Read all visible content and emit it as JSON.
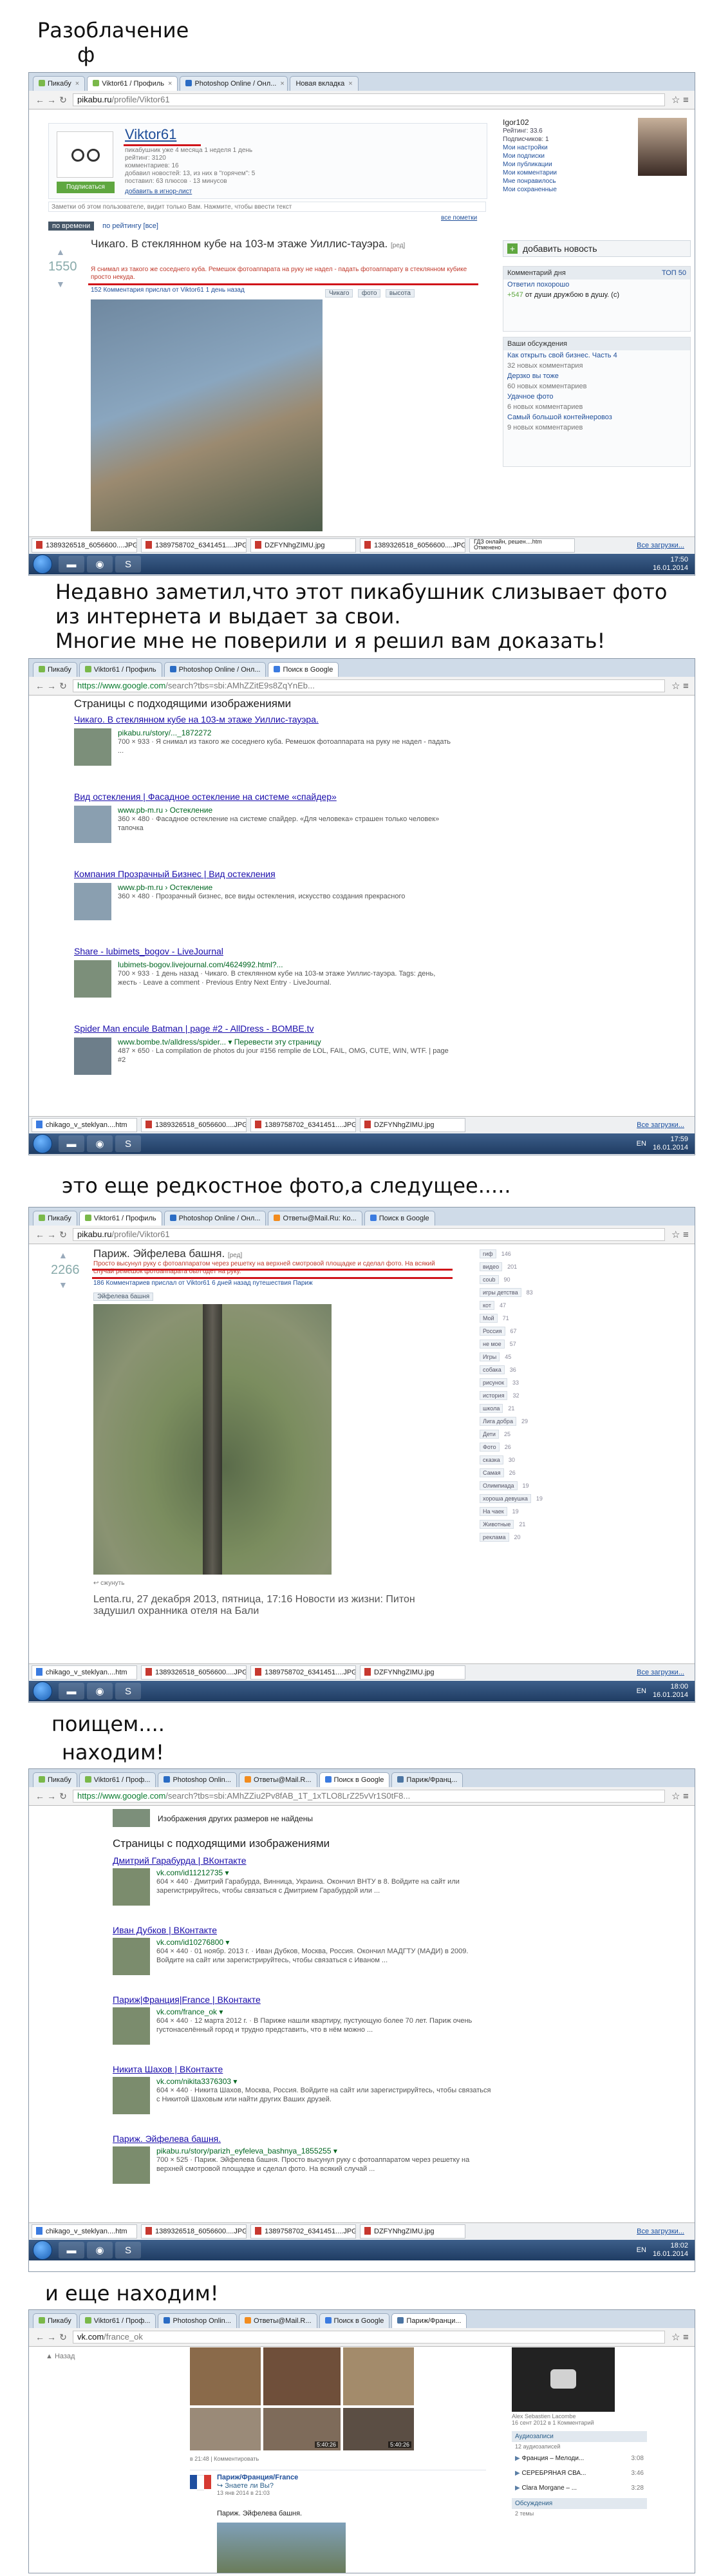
{
  "captions": {
    "title_line1": "Разоблачение",
    "title_line2": "ф",
    "after_shot1": "Недавно заметил,что этот пикабушник слизывает фото\nиз интернета и выдает за свои.\nМногие мне не поверили и я решил вам доказать!",
    "after_shot2": "это еще редкостное фото,а следущее.....",
    "after_shot3_a": "поищем....",
    "after_shot3_b": "находим!",
    "after_shot4": "и еще находим!"
  },
  "shot1": {
    "tabs": [
      "Пикабу",
      "Viktor61 / Профиль",
      "Photoshop Online / Онл...",
      "Новая вкладка"
    ],
    "url_domain": "pikabu.ru",
    "url_path": "/profile/Viktor61",
    "profile": {
      "username": "Viktor61",
      "stats": [
        "пикабушник уже 4 месяца 1 неделя 1 день",
        "рейтинг: 3120",
        "комментариев: 16",
        "добавил новостей: 13, из них в \"горячем\": 5",
        "поставил: 63 плюсов · 13 минусов"
      ],
      "subscribe": "Подписаться",
      "ignore": "добавить в игнор-лист"
    },
    "note": "Заметки об этом пользователе, видит только Вам. Нажмите, чтобы ввести текст",
    "all_notes": "все пометки",
    "sort": "по времени",
    "sort_tabs": "по рейтингу  [все]",
    "post": {
      "rating": "1550",
      "title": "Чикаго. В стеклянном кубе на 103-м этаже Уиллис-тауэра.",
      "tag_label": "[ред]",
      "body": "Я снимал из такого же соседнего куба. Ремешок фотоаппарата на руку не надел - падать фотоаппарату в стеклянном кубике просто некуда.",
      "meta": "152 Комментария  прислал от Viktor61 1 день назад",
      "tags": [
        "Чикаго",
        "фото",
        "высота"
      ]
    },
    "user_panel": {
      "name": "Igor102",
      "items": [
        "Рейтинг: 33.6",
        "Подписчиков: 1",
        "Мои настройки",
        "Мои подписки",
        "Мои публикации",
        "Мои комментарии",
        "Мне понравилось",
        "Мои сохраненные"
      ]
    },
    "add_news": "добавить новость",
    "comments_day": {
      "head": "Комментарий дня",
      "top": "ТОП 50",
      "title": "Ответил похорошо",
      "count": "+547",
      "text": "от души дружбою в душу. (с)"
    },
    "discussions": {
      "head": "Ваши обсуждения",
      "items": [
        [
          "Как открыть свой бизнес. Часть 4",
          "32 новых комментария"
        ],
        [
          "Дерзко вы тоже",
          "60 новых комментариев"
        ],
        [
          "Удачное фото",
          "6 новых комментариев"
        ],
        [
          "Самый большой контейнеровоз",
          "9 новых комментариев"
        ]
      ]
    },
    "downloads": [
      "1389326518_6056600....JPG",
      "1389758702_6341451....JPG",
      "DZFYNhgZIMU.jpg",
      "1389326518_6056600....JPG",
      "ГДЗ онлайн, решен....htm"
    ],
    "dl_state": "Отменено",
    "dl_all": "Все загрузки...",
    "lang": "EN",
    "time": "17:50",
    "date": "16.01.2014"
  },
  "shot2": {
    "tabs": [
      "Пикабу",
      "Viktor61 / Профиль",
      "Photoshop Online / Онл...",
      "Поиск в Google"
    ],
    "url_domain": "https://www.google.com",
    "url_path": "/search?tbs=sbi:AMhZZitE9s8ZqYnEb...",
    "heading": "Страницы с подходящими изображениями",
    "results": [
      {
        "title": "Чикаго. В стеклянном кубе на 103-м этаже Уиллис-тауэра.",
        "url": "pikabu.ru/story/..._1872272",
        "meta": "700 × 933 · Я снимал из такого же соседнего куба. Ремешок фотоаппарата на руку не надел - падать ..."
      },
      {
        "title": "Вид остекления | Фасадное остекление на системе «спайдер»",
        "url": "www.pb-m.ru › Остекление",
        "meta": "360 × 480 · Фасадное остекление на системе спайдер. «Для человека» страшен только человек» тапочка"
      },
      {
        "title": "Компания Прозрачный Бизнес | Вид остекления",
        "url": "www.pb-m.ru › Остекление",
        "meta": "360 × 480 · Прозрачный бизнес, все виды остекления, искусство создания прекрасного"
      },
      {
        "title": "Share - lubimets_bogov - LiveJournal",
        "url": "lubimets-bogov.livejournal.com/4624992.html?...",
        "meta": "700 × 933 · 1 день назад · Чикаго. В стеклянном кубе на 103-м этаже Уиллис-тауэра. Tags: день, жесть · Leave a comment · Previous Entry Next Entry · LiveJournal."
      },
      {
        "title": "Spider Man encule Batman | page #2 - AllDress - BOMBE.tv",
        "url": "www.bombe.tv/alldress/spider... ▾ Перевести эту страницу",
        "meta": "487 × 650 · La compilation de photos du jour #156 remplie de LOL, FAIL, OMG, CUTE, WIN, WTF. | page #2"
      }
    ],
    "downloads": [
      "chikago_v_steklyan....htm",
      "1389326518_6056600....JPG",
      "1389758702_6341451....JPG",
      "DZFYNhgZIMU.jpg"
    ],
    "dl_all": "Все загрузки...",
    "lang": "EN",
    "time": "17:59",
    "date": "16.01.2014"
  },
  "shot3": {
    "tabs": [
      "Пикабу",
      "Viktor61 / Профиль",
      "Photoshop Online / Онл...",
      "Ответы@Mail.Ru: Ко...",
      "Поиск в Google"
    ],
    "url_domain": "pikabu.ru",
    "url_path": "/profile/Viktor61",
    "post": {
      "rating": "2266",
      "title": "Париж. Эйфелева башня.",
      "tag_label": "[ред]",
      "body": "Просто высунул руку с фотоаппаратом через решетку на верхней смотровой площадке и сделал фото. На всякий случай ремешок фотоаппарата был одет на руку.",
      "meta": "186 Комментариев  прислал от Viktor61 6 дней назад  путешествия  Париж",
      "tags": [
        "Эйфелева башня"
      ],
      "share": "сжунуть"
    },
    "next_post": "Lenta.ru, 27 декабря 2013, пятница, 17:16 Новости из жизни: Питон задушил охранника отеля на Бали",
    "tag_cloud": [
      [
        "гиф",
        "146"
      ],
      [
        "видео",
        "201"
      ],
      [
        "coub",
        "90"
      ],
      [
        "игры детства",
        "83"
      ],
      [
        "кот",
        "47"
      ],
      [
        "Мой",
        "71"
      ],
      [
        "Россия",
        "67"
      ],
      [
        "не мое",
        "57"
      ],
      [
        "Игры",
        "45"
      ],
      [
        "собака",
        "36"
      ],
      [
        "рисунок",
        "33"
      ],
      [
        "история",
        "32"
      ],
      [
        "школа",
        "21"
      ],
      [
        "Лига добра",
        "29"
      ],
      [
        "Дети",
        "25"
      ],
      [
        "Фото",
        "26"
      ],
      [
        "сказка",
        "30"
      ],
      [
        "Самая",
        "26"
      ],
      [
        "Олимпиада",
        "19"
      ],
      [
        "хороша девушка",
        "19"
      ],
      [
        "На чаек",
        "19"
      ],
      [
        "Животные",
        "21"
      ],
      [
        "реклама",
        "20"
      ]
    ],
    "downloads": [
      "chikago_v_steklyan....htm",
      "1389326518_6056600....JPG",
      "1389758702_6341451....JPG",
      "DZFYNhgZIMU.jpg"
    ],
    "dl_all": "Все загрузки...",
    "lang": "EN",
    "time": "18:00",
    "date": "16.01.2014"
  },
  "shot4": {
    "tabs": [
      "Пикабу",
      "Viktor61 / Проф...",
      "Photoshop Onlin...",
      "Ответы@Mail.R...",
      "Поиск в Google",
      "Париж/Франц..."
    ],
    "url_domain": "https://www.google.com",
    "url_path": "/search?tbs=sbi:AMhZZiu2Pv8fAB_1T_1xTLO8LrZ25vVr1S0tF8...",
    "other_sizes": "Изображения других размеров не найдены",
    "heading": "Страницы с подходящими изображениями",
    "results": [
      {
        "title": "Дмитрий Гарабурда | ВКонтакте",
        "url": "vk.com/id11212735 ▾",
        "meta": "604 × 440 · Дмитрий Гарабурда, Винница, Украина. Окончил ВНТУ в 8. Войдите на сайт или зарегистрируйтесь, чтобы связаться с Дмитрием Гарабурдой или ..."
      },
      {
        "title": "Иван Дубков | ВКонтакте",
        "url": "vk.com/id10276800 ▾",
        "meta": "604 × 440 · 01 ноябр. 2013 г. · Иван Дубков, Москва, Россия. Окончил МАДГТУ (МАДИ) в 2009. Войдите на сайт или зарегистрируйтесь, чтобы связаться с Иваном ..."
      },
      {
        "title": "Париж|Франция|France | ВКонтакте",
        "url": "vk.com/france_ok ▾",
        "meta": "604 × 440 · 12 марта 2012 г. · В Париже нашли квартиру, пустующую более 70 лет. Париж очень густонаселённый город и трудно представить, что в нём можно ..."
      },
      {
        "title": "Никита Шахов | ВКонтакте",
        "url": "vk.com/nikita3376303 ▾",
        "meta": "604 × 440 · Никита Шахов, Москва, Россия. Войдите на сайт или зарегистрируйтесь, чтобы связаться с Никитой Шаховым или найти других Ваших друзей."
      },
      {
        "title": "Париж. Эйфелева башня.",
        "url": "pikabu.ru/story/parizh_eyfeleva_bashnya_1855255 ▾",
        "meta": "700 × 525 · Париж. Эйфелева башня. Просто высунул руку с фотоаппаратом через решетку на верхней смотровой площадке и сделал фото. На всякий случай ..."
      }
    ],
    "downloads": [
      "chikago_v_steklyan....htm",
      "1389326518_6056600....JPG",
      "1389758702_6341451....JPG",
      "DZFYNhgZIMU.jpg"
    ],
    "dl_all": "Все загрузки...",
    "lang": "EN",
    "time": "18:02",
    "date": "16.01.2014"
  },
  "shot5": {
    "tabs": [
      "Пикабу",
      "Viktor61 / Проф...",
      "Photoshop Onlin...",
      "Ответы@Mail.R...",
      "Поиск в Google",
      "Париж/Франци..."
    ],
    "url_domain": "vk.com",
    "url_path": "/france_ok",
    "left_menu": [
      "Назад"
    ],
    "post": {
      "group": "Париж/Франция/France",
      "sub": "Знаете ли Вы?",
      "date": "13 янв 2014 в 21:03",
      "text": "Париж. Эйфелева башня."
    },
    "video_time": "5:40:26",
    "video_time2": "5:40:26",
    "video_author": "Alex Sebastien Lacombe",
    "video_date": "16 сент 2012 в 1 Комментарий",
    "audio_head": "Аудиозаписи",
    "audio_count": "12 аудиозаписей",
    "audio": [
      [
        "Франция – Мелоди...",
        "3:08"
      ],
      [
        "СЕРЕБРЯНАЯ СВА...",
        "3:46"
      ],
      [
        "Clara Morgane – ...",
        "3:28"
      ]
    ],
    "discuss_head": "Обсуждения",
    "discuss_count": "2 темы",
    "small_meta": "в 21:48  |  Комментировать"
  }
}
